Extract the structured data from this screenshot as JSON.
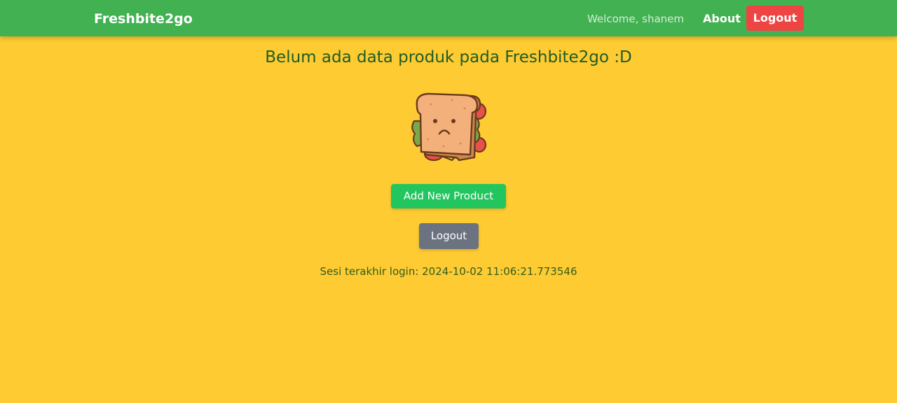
{
  "navbar": {
    "brand": "Freshbite2go",
    "welcome_text": "Welcome, shanem",
    "about_label": "About",
    "logout_label": "Logout"
  },
  "main": {
    "empty_message": "Belum ada data produk pada Freshbite2go :D",
    "illustration_icon": "sad-sandwich-icon",
    "add_product_label": "Add New Product",
    "logout_label": "Logout",
    "last_login_text": "Sesi terakhir login: 2024-10-02 11:06:21.773546"
  },
  "colors": {
    "background": "#fecb32",
    "navbar": "#41b152",
    "nav_logout": "#ef4444",
    "add_button": "#22c55e",
    "logout_button": "#6b7280",
    "heading_text": "#1f5c27"
  }
}
